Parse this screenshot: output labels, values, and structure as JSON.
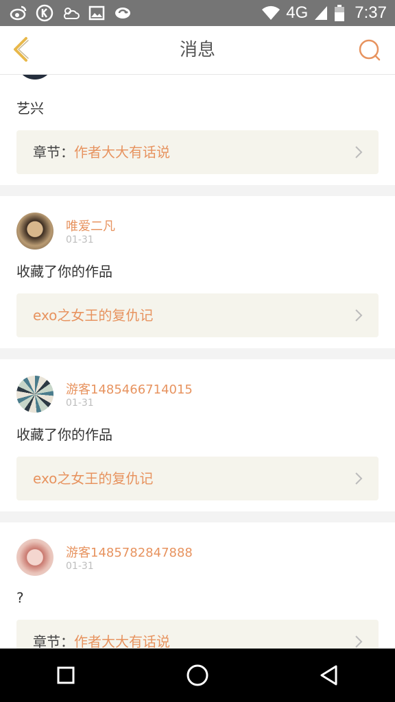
{
  "statusbar": {
    "icons_left": [
      "weibo-icon",
      "k-app-icon",
      "weather-icon",
      "image-icon",
      "sync-icon"
    ],
    "network": "4G",
    "time": "7:37"
  },
  "header": {
    "title": "消息",
    "back_icon": "chevron-left-icon",
    "chat_icon": "chat-bubble-icon"
  },
  "messages": [
    {
      "name": "",
      "date": "",
      "text": "艺兴",
      "ref_label": "章节：",
      "ref_value": "作者大大有话说"
    },
    {
      "name": "唯爱二凡",
      "date": "01-31",
      "text": "收藏了你的作品",
      "ref_label": "",
      "ref_value": "exo之女王的复仇记"
    },
    {
      "name": "游客1485466714015",
      "date": "01-31",
      "text": "收藏了你的作品",
      "ref_label": "",
      "ref_value": "exo之女王的复仇记"
    },
    {
      "name": "游客1485782847888",
      "date": "01-31",
      "text": "?",
      "ref_label": "章节：",
      "ref_value": "作者大大有话说"
    }
  ],
  "navbar": {
    "buttons": [
      "recent-apps",
      "home",
      "back"
    ]
  },
  "colors": {
    "accent": "#e7935f",
    "ref_bg": "#f5f4ec",
    "statusbar": "#757575"
  }
}
